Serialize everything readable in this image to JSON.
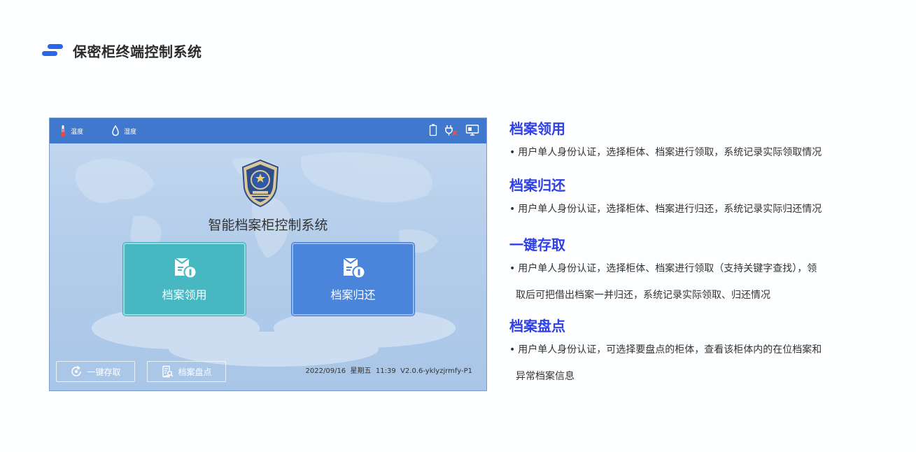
{
  "page": {
    "title": "保密柜终端控制系统"
  },
  "device": {
    "status_bar": {
      "temperature_label": "温度",
      "humidity_label": "湿度"
    },
    "system_name": "智能档案柜控制系统",
    "buttons": {
      "borrow": "档案领用",
      "return": "档案归还",
      "one_key": "一键存取",
      "inventory": "档案盘点"
    },
    "footer": {
      "date": "2022/09/16",
      "weekday": "星期五",
      "time": "11:39",
      "version": "V2.0.6-yklyzjrmfy-P1"
    }
  },
  "features": [
    {
      "title": "档案领用",
      "lines": [
        "用户单人身份认证，选择柜体、档案进行领取，系统记录实际领取情况"
      ]
    },
    {
      "title": "档案归还",
      "lines": [
        "用户单人身份认证，选择柜体、档案进行归还，系统记录实际归还情况"
      ]
    },
    {
      "title": "一键存取",
      "lines": [
        "用户单人身份认证，选择柜体、档案进行领取（支持关键字查找），领",
        "取后可把借出档案一并归还，系统记录实际领取、归还情况"
      ]
    },
    {
      "title": "档案盘点",
      "lines": [
        "用户单人身份认证，可选择要盘点的柜体，查看该柜体内的在位档案和",
        "异常档案信息"
      ]
    }
  ],
  "bullet": "•",
  "colors": {
    "accent": "#2f40e6",
    "brand": "#2a66e8",
    "status_bar": "#3f78cc",
    "borrow_button": "#47b8c2",
    "return_button": "#4a84db"
  }
}
